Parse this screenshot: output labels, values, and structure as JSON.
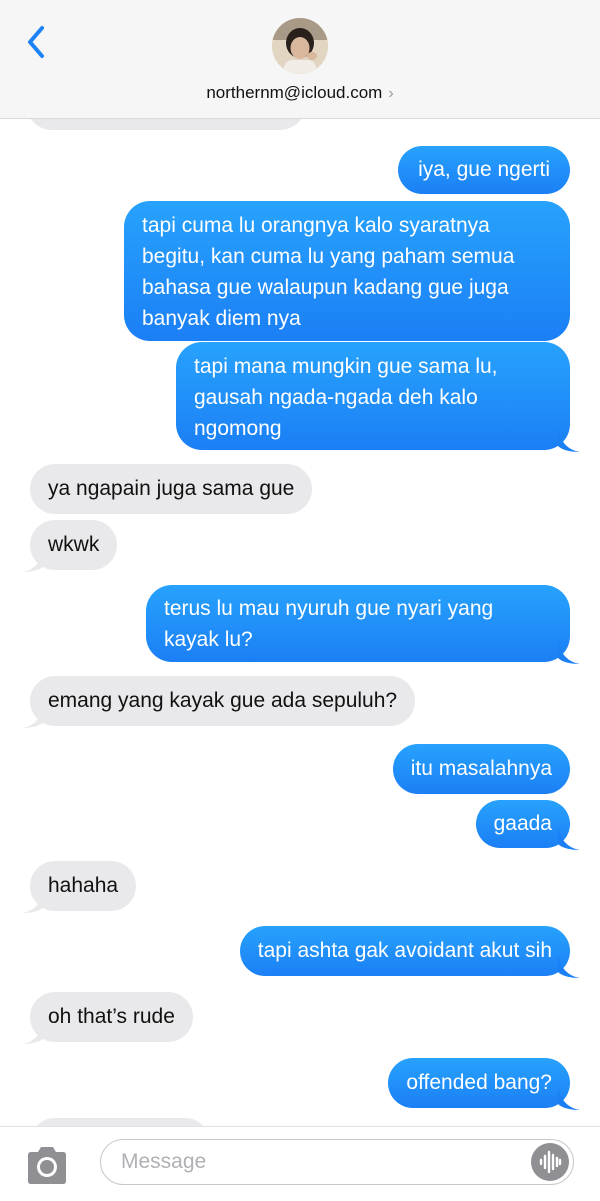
{
  "header": {
    "contact": "northernm@icloud.com",
    "back_icon": "chevron-left-icon",
    "accent": "#1c83f6"
  },
  "messages": [
    {
      "side": "received",
      "text": ""
    },
    {
      "side": "sent",
      "text": "iya, gue ngerti"
    },
    {
      "side": "sent",
      "text": "tapi cuma lu orangnya kalo syaratnya begitu, kan cuma lu yang paham semua bahasa gue walaupun kadang gue juga banyak diem nya"
    },
    {
      "side": "sent",
      "text": "tapi mana mungkin gue sama lu, gausah ngada-ngada deh kalo ngomong"
    },
    {
      "side": "received",
      "text": "ya ngapain juga sama gue"
    },
    {
      "side": "received",
      "text": "wkwk"
    },
    {
      "side": "sent",
      "text": "terus lu mau nyuruh gue nyari yang kayak lu?"
    },
    {
      "side": "received",
      "text": "emang yang kayak gue ada sepuluh?"
    },
    {
      "side": "sent",
      "text": "itu masalahnya"
    },
    {
      "side": "sent",
      "text": "gaada"
    },
    {
      "side": "received",
      "text": "hahaha"
    },
    {
      "side": "sent",
      "text": "tapi ashta gak avoidant akut sih"
    },
    {
      "side": "received",
      "text": "oh that’s rude"
    },
    {
      "side": "sent",
      "text": "offended bang?"
    },
    {
      "side": "received",
      "text": ""
    }
  ],
  "composer": {
    "placeholder": "Message",
    "camera_icon": "camera-icon",
    "voice_icon": "audio-waveform-icon"
  },
  "colors": {
    "sent_bubble": "#1c83f6",
    "received_bubble": "#e9e9eb",
    "header_bg": "#f6f6f7"
  }
}
